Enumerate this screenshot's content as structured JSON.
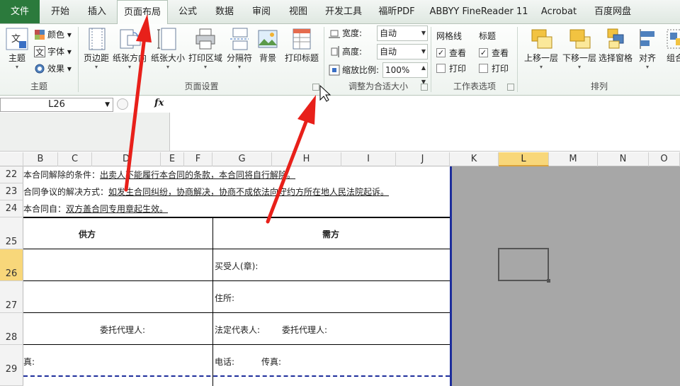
{
  "tabs": [
    "文件",
    "开始",
    "插入",
    "页面布局",
    "公式",
    "数据",
    "审阅",
    "视图",
    "开发工具",
    "福昕PDF",
    "ABBYY FineReader 11",
    "Acrobat",
    "百度网盘"
  ],
  "ribbon": {
    "theme": {
      "themes": "主题",
      "colors": "颜色",
      "fonts": "字体",
      "effects": "效果",
      "label": "主题"
    },
    "page_setup": {
      "margins": "页边距",
      "orientation": "纸张方向",
      "size": "纸张大小",
      "print_area": "打印区域",
      "breaks": "分隔符",
      "background": "背景",
      "print_titles": "打印标题",
      "label": "页面设置"
    },
    "scale": {
      "width_label": "宽度:",
      "width_value": "自动",
      "height_label": "高度:",
      "height_value": "自动",
      "scale_label": "缩放比例:",
      "scale_value": "100%",
      "label": "调整为合适大小"
    },
    "sheet_options": {
      "gridlines": "网格线",
      "headings": "标题",
      "view": "查看",
      "print": "打印",
      "label": "工作表选项"
    },
    "arrange": {
      "bring_forward": "上移一层",
      "send_backward": "下移一层",
      "selection_pane": "选择窗格",
      "align": "对齐",
      "group": "组合",
      "label": "排列"
    }
  },
  "formula_bar": {
    "name_box": "L26",
    "fx": "fx",
    "formula": ""
  },
  "columns": [
    "B",
    "C",
    "D",
    "E",
    "F",
    "G",
    "H",
    "I",
    "J",
    "K",
    "L",
    "M",
    "N",
    "O"
  ],
  "rows": [
    "22",
    "23",
    "24",
    "25",
    "26",
    "27",
    "28",
    "29"
  ],
  "selected_cell": {
    "column": "L",
    "row": "26"
  },
  "sheet": {
    "r22_label": "本合同解除的条件：",
    "r22_value": "出卖人不能履行本合同的条款，本合同将自行解除。",
    "r23_label": "合同争议的解决方式：",
    "r23_value": "如发生合同纠纷，协商解决，协商不成依法向守约方所在地人民法院起诉。",
    "r24_label": "本合同自：",
    "r24_value": "双方盖合同专用章起生效。",
    "supplier": "供方",
    "buyer": "需方",
    "buyer_seal": "买受人(章):",
    "address": "住所:",
    "agent_left": "委托代理人:",
    "legal_rep": "法定代表人:",
    "agent_right": "委托代理人:",
    "fax_left": "真:",
    "phone": "电话:",
    "fax_right": "传真:"
  },
  "colors": {
    "file_tab": "#2b7a3c",
    "selection_header": "#f8d77a",
    "page_break": "#1e2e9c",
    "arrow": "#e8201a"
  }
}
